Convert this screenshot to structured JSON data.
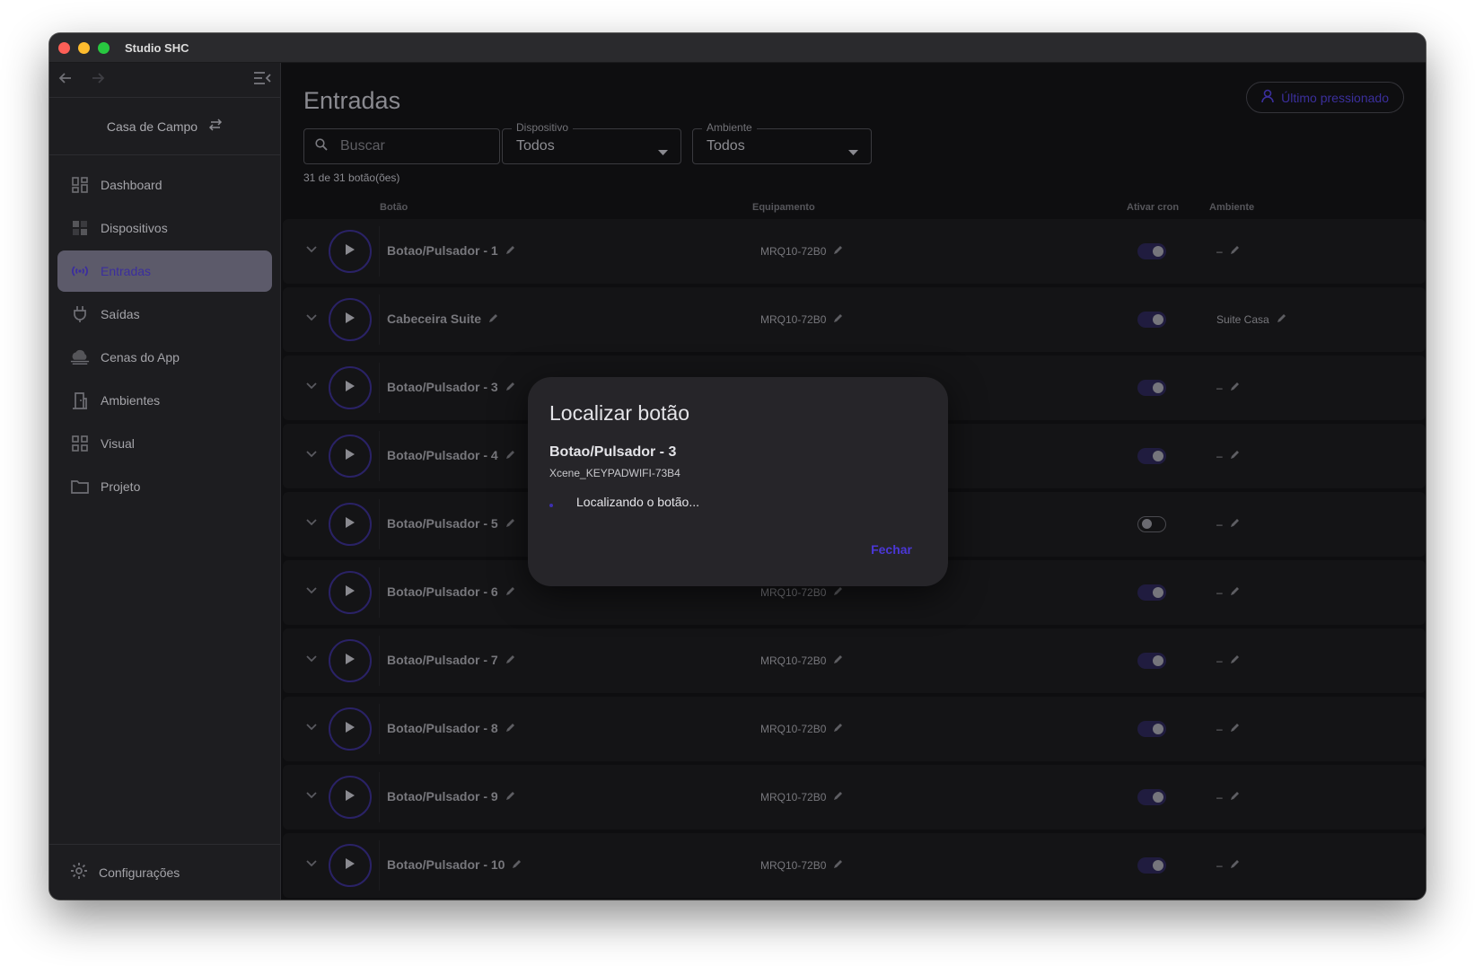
{
  "window": {
    "title": "Studio SHC"
  },
  "sidebar": {
    "project": "Casa de Campo",
    "items": [
      {
        "label": "Dashboard",
        "icon": "dashboard-icon"
      },
      {
        "label": "Dispositivos",
        "icon": "devices-icon"
      },
      {
        "label": "Entradas",
        "icon": "broadcast-icon",
        "active": true
      },
      {
        "label": "Saídas",
        "icon": "plug-icon"
      },
      {
        "label": "Cenas do App",
        "icon": "cloud-icon"
      },
      {
        "label": "Ambientes",
        "icon": "door-icon"
      },
      {
        "label": "Visual",
        "icon": "grid-icon"
      },
      {
        "label": "Projeto",
        "icon": "folder-icon"
      }
    ],
    "footer": {
      "label": "Configurações",
      "icon": "gear-icon"
    }
  },
  "main": {
    "title": "Entradas",
    "last_pressed": "Último pressionado",
    "search": {
      "placeholder": "Buscar"
    },
    "filters": {
      "device": {
        "label": "Dispositivo",
        "value": "Todos"
      },
      "environment": {
        "label": "Ambiente",
        "value": "Todos"
      }
    },
    "count": "31 de 31 botão(ões)",
    "columns": {
      "button": "Botão",
      "equipment": "Equipamento",
      "cron": "Ativar cron",
      "environment": "Ambiente"
    },
    "rows": [
      {
        "name": "Botao/Pulsador - 1",
        "equipment": "MRQ10-72B0",
        "cron": true,
        "environment": "–"
      },
      {
        "name": "Cabeceira Suite",
        "equipment": "MRQ10-72B0",
        "cron": true,
        "environment": "Suite Casa"
      },
      {
        "name": "Botao/Pulsador - 3",
        "equipment": "",
        "cron": true,
        "environment": "–"
      },
      {
        "name": "Botao/Pulsador - 4",
        "equipment": "",
        "cron": true,
        "environment": "–"
      },
      {
        "name": "Botao/Pulsador - 5",
        "equipment": "",
        "cron": false,
        "environment": "–"
      },
      {
        "name": "Botao/Pulsador - 6",
        "equipment": "MRQ10-72B0",
        "cron": true,
        "environment": "–"
      },
      {
        "name": "Botao/Pulsador - 7",
        "equipment": "MRQ10-72B0",
        "cron": true,
        "environment": "–"
      },
      {
        "name": "Botao/Pulsador - 8",
        "equipment": "MRQ10-72B0",
        "cron": true,
        "environment": "–"
      },
      {
        "name": "Botao/Pulsador - 9",
        "equipment": "MRQ10-72B0",
        "cron": true,
        "environment": "–"
      },
      {
        "name": "Botao/Pulsador - 10",
        "equipment": "MRQ10-72B0",
        "cron": true,
        "environment": "–"
      }
    ]
  },
  "modal": {
    "title": "Localizar botão",
    "button_name": "Botao/Pulsador - 3",
    "device": "Xcene_KEYPADWIFI-73B4",
    "status": "Localizando o botão...",
    "close_label": "Fechar"
  },
  "colors": {
    "accent": "#4b37d6",
    "active_bg": "#5c5a6a",
    "background": "#0e0e10"
  }
}
